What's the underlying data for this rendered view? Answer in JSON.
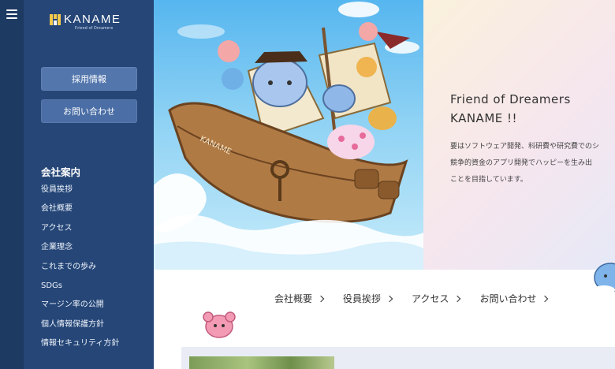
{
  "logo": {
    "text": "KANAME",
    "subtitle": "Friend of Dreamers"
  },
  "sidebar": {
    "buttons": [
      "採用情報",
      "お問い合わせ"
    ],
    "section_title": "会社案内",
    "items": [
      {
        "label": "役員挨拶"
      },
      {
        "label": "会社概要"
      },
      {
        "label": "アクセス"
      },
      {
        "label": "企業理念"
      },
      {
        "label": "これまでの歩み"
      },
      {
        "label": "SDGs"
      },
      {
        "label": "マージン率の公開"
      },
      {
        "label": "個人情報保護方針"
      },
      {
        "label": "情報セキュリティ方針"
      }
    ]
  },
  "hero": {
    "title_line1": "Friend of Dreamers",
    "title_line2": "KANAME !!",
    "desc_line1": "要はソフトウェア開発、科研費や研究費でのシ",
    "desc_line2": "競争的資金のアプリ開発でハッピーを生み出",
    "desc_line3": "ことを目指しています。",
    "ship_name": "KANAME"
  },
  "links": [
    {
      "label": "会社概要"
    },
    {
      "label": "役員挨拶"
    },
    {
      "label": "アクセス"
    },
    {
      "label": "お問い合わせ"
    }
  ],
  "colors": {
    "sidebar": "#254677",
    "rail": "#1d3a63",
    "button": "#4a6ea5"
  }
}
